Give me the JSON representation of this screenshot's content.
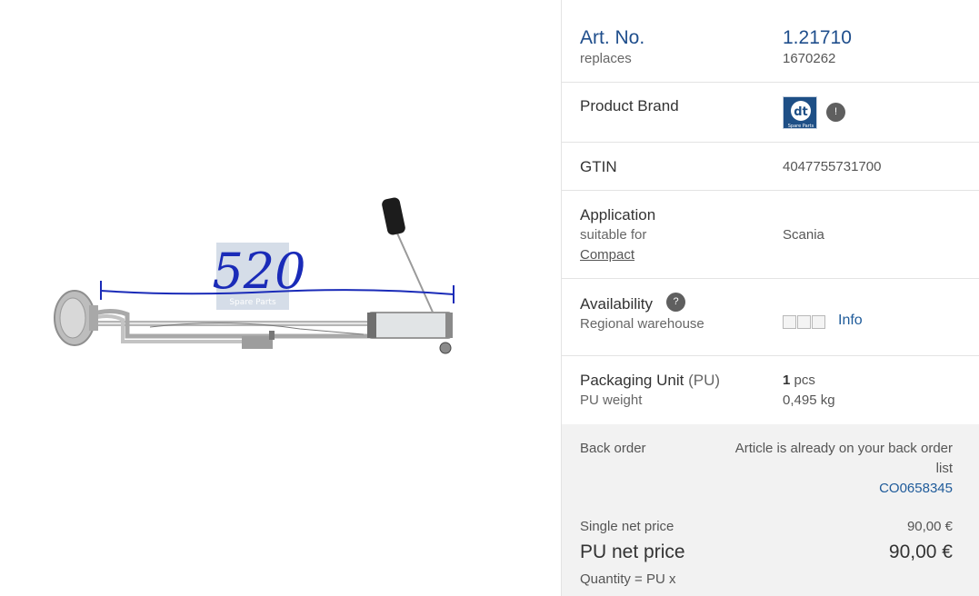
{
  "product_image": {
    "dimension_annotation": "520",
    "watermark": "Spare Parts"
  },
  "details": {
    "art_no": {
      "label": "Art. No.",
      "value": "1.21710",
      "replaces_label": "replaces",
      "replaces_value": "1670262"
    },
    "brand": {
      "label": "Product Brand",
      "logo_text": "Spare Parts",
      "info_badge": "!"
    },
    "gtin": {
      "label": "GTIN",
      "value": "4047755731700"
    },
    "application": {
      "label": "Application",
      "suitable_for": "suitable for",
      "model": "Compact",
      "value": "Scania"
    },
    "availability": {
      "label": "Availability",
      "help_badge": "?",
      "sub_label": "Regional warehouse",
      "info_link": "Info"
    },
    "packaging": {
      "label_main": "Packaging Unit",
      "label_abbr": "(PU)",
      "qty": "1",
      "qty_unit": "pcs",
      "weight_label": "PU weight",
      "weight_value": "0,495 kg"
    }
  },
  "pricing": {
    "back_order_label": "Back order",
    "back_order_text_line1": "Article is already on your back order",
    "back_order_text_line2": "list",
    "back_order_code": "CO0658345",
    "single_price_label": "Single net price",
    "single_price_value": "90,00 €",
    "pu_price_label": "PU net price",
    "pu_price_value": "90,00 €",
    "quantity_label": "Quantity = PU x"
  },
  "colors": {
    "accent_blue": "#1f4e8c",
    "link_blue": "#1f5b9a",
    "annotation_pen": "#1a2bb8",
    "panel_gray": "#f2f2f2"
  }
}
